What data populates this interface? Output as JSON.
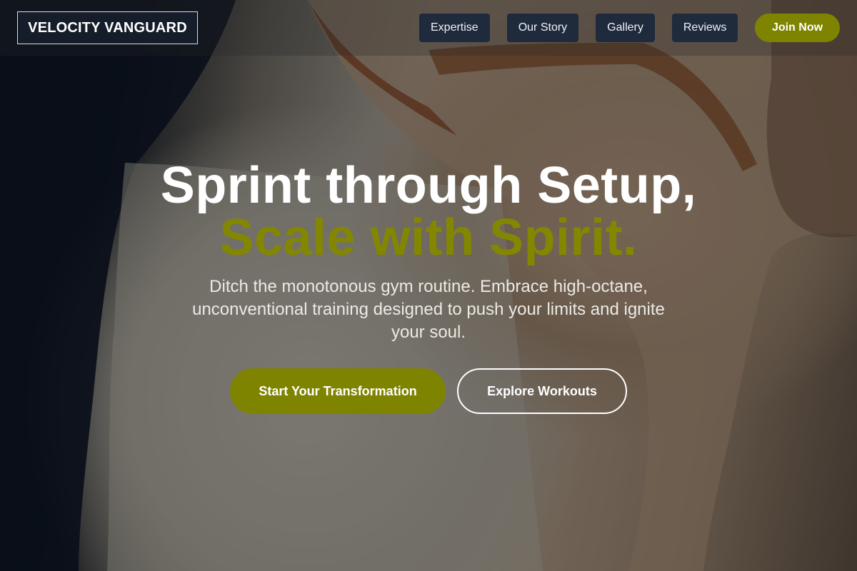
{
  "brand": {
    "name": "VELOCITY VANGUARD"
  },
  "nav": {
    "links": [
      {
        "label": "Expertise"
      },
      {
        "label": "Our Story"
      },
      {
        "label": "Gallery"
      },
      {
        "label": "Reviews"
      }
    ],
    "cta_label": "Join Now"
  },
  "hero": {
    "headline_line1": "Sprint through Setup,",
    "headline_line2": "Scale with Spirit.",
    "subtitle": "Ditch the monotonous gym routine. Embrace high-octane, unconventional training designed to push your limits and ignite your soul.",
    "primary_cta": "Start Your Transformation",
    "secondary_cta": "Explore Workouts"
  },
  "colors": {
    "accent": "#7f8400",
    "nav_button_bg": "#1f2a3c",
    "brand_bg": "#161e2c",
    "text_light": "#ffffff"
  }
}
